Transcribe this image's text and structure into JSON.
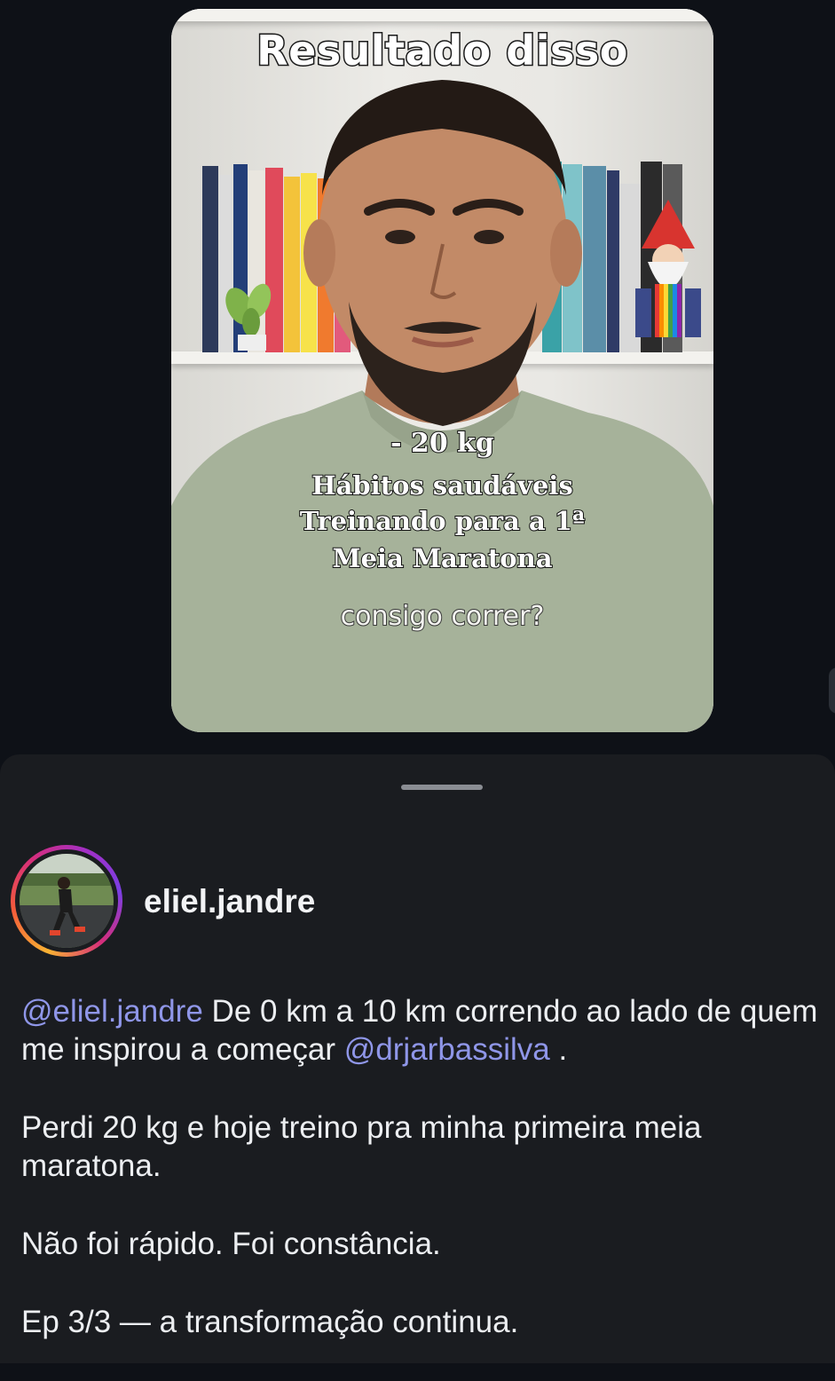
{
  "media": {
    "title_text": "Resultado disso",
    "overlay_lines": [
      "- 20 kg",
      "Hábitos saudáveis",
      "Treinando para a 1ª",
      "Meia Maratona"
    ],
    "question_text": "consigo correr?"
  },
  "post": {
    "username": "eliel.jandre",
    "caption": {
      "mention_1": "@eliel.jandre",
      "text_1": " De 0 km a 10 km correndo ao lado de quem me inspirou a começar ",
      "mention_2": "@drjarbassilva",
      "text_2": " .",
      "paragraph_2": "Perdi 20 kg e hoje treino pra minha primeira meia maratona.",
      "paragraph_3": "Não foi rápido. Foi constância.",
      "paragraph_4": "Ep 3/3 — a transformação continua."
    }
  },
  "colors": {
    "background": "#0e1117",
    "sheet": "#1a1c20",
    "mention": "#8f96e8",
    "text": "#eceef1"
  },
  "icons": [
    "threads-icon"
  ]
}
